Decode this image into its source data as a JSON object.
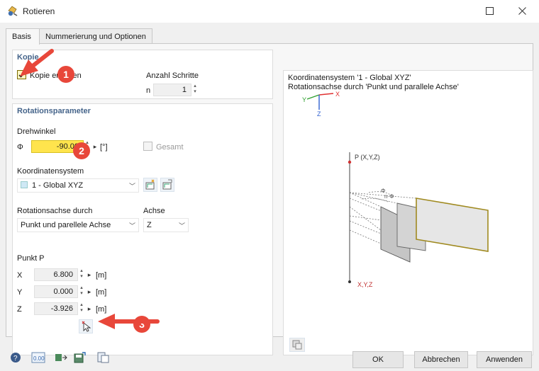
{
  "window": {
    "title": "Rotieren"
  },
  "tabs": [
    {
      "label": "Basis"
    },
    {
      "label": "Nummerierung und Optionen"
    }
  ],
  "copy_group": {
    "title": "Kopie",
    "copy_checkbox_label": "Kopie erstellen",
    "copy_checked": true,
    "steps_label": "Anzahl Schritte",
    "steps_var": "n",
    "steps_value": "1"
  },
  "rotation_group": {
    "title": "Rotationsparameter",
    "angle_label": "Drehwinkel",
    "angle_symbol": "Φ",
    "angle_value": "-90.00",
    "angle_unit": "[°]",
    "total_label": "Gesamt",
    "coord_label": "Koordinatensystem",
    "coord_value": "1 - Global XYZ",
    "axis_through_label": "Rotationsachse durch",
    "axis_through_value": "Punkt und parellele Achse",
    "axis_label": "Achse",
    "axis_value": "Z",
    "point_label": "Punkt P",
    "point": [
      {
        "axis": "X",
        "value": "6.800",
        "unit": "[m]"
      },
      {
        "axis": "Y",
        "value": "0.000",
        "unit": "[m]"
      },
      {
        "axis": "Z",
        "value": "-3.926",
        "unit": "[m]"
      }
    ]
  },
  "preview": {
    "line1": "Koordinatensystem '1 - Global XYZ'",
    "line2": "Rotationsachse durch 'Punkt und parallele Achse'",
    "axis_x": "X",
    "axis_y": "Y",
    "axis_z": "Z",
    "point_label": "P (X,Y,Z)",
    "origin_label": "X,Y,Z",
    "phi_label": "Φ",
    "nphi_label": "n·Φ"
  },
  "callouts": [
    "1",
    "2",
    "3"
  ],
  "buttons": {
    "ok": "OK",
    "cancel": "Abbrechen",
    "apply": "Anwenden"
  },
  "colors": {
    "accent": "#45648a",
    "highlight": "#ffe44d",
    "callout": "#e8473a",
    "axis_x": "#e03030",
    "axis_y": "#30a030",
    "axis_z": "#3060d0"
  }
}
